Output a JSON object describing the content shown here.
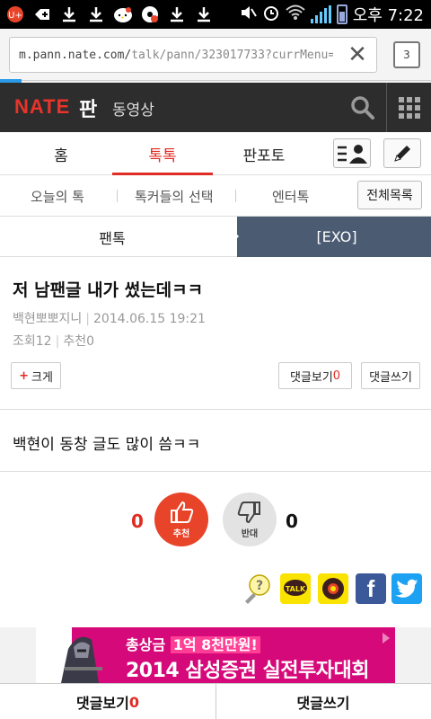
{
  "status_bar": {
    "time": "오후 7:22",
    "icons": [
      "u-plus-icon",
      "add-icon",
      "download-icon",
      "download-icon",
      "hello-kitty-icon",
      "cd-icon",
      "download-icon",
      "download-icon",
      "mute-icon",
      "alarm-icon",
      "wifi-icon",
      "signal-icon",
      "battery-icon"
    ]
  },
  "browser": {
    "url_host": "m.pann.nate.com/",
    "url_path": "talk/pann/323017733?currMenu=",
    "tab_count": "3"
  },
  "header": {
    "logo": "NATE",
    "section": "판",
    "video_link": "동영상"
  },
  "main_tabs": [
    {
      "label": "홈"
    },
    {
      "label": "톡톡",
      "active": true
    },
    {
      "label": "판포토"
    }
  ],
  "sub_tabs": [
    {
      "label": "오늘의 톡"
    },
    {
      "label": "톡커들의 선택"
    },
    {
      "label": "엔터톡"
    }
  ],
  "sub_tabs_all": "전체목록",
  "breadcrumb": {
    "left": "팬톡",
    "right": "[EXO]"
  },
  "post": {
    "title": "저 남팬글 내가 썼는데ㅋㅋ",
    "author": "백현뽀뽀지니",
    "date": "2014.06.15 19:21",
    "views_label": "조회",
    "views": "12",
    "recommend_label": "추천",
    "recommend": "0",
    "font_bigger": "크게",
    "comment_view_label": "댓글보기",
    "comment_count": "0",
    "comment_write": "댓글쓰기",
    "body": "백현이 동창 글도 많이 씀ㅋㅋ"
  },
  "votes": {
    "up_count": "0",
    "up_label": "추천",
    "down_label": "반대",
    "down_count": "0"
  },
  "share": {
    "talk_label": "TALK",
    "facebook_label": "f"
  },
  "ad": {
    "prize_prefix": "총상금",
    "prize_amount": "1억 8천만원!",
    "headline": "2014 삼성증권 실전투자대회"
  },
  "bottom_bar": {
    "comment_view_label": "댓글보기",
    "comment_count": "0",
    "comment_write": "댓글쓰기"
  },
  "colors": {
    "accent_red": "#e02c24",
    "header_bg": "#2d2d2d",
    "breadcrumb_bg": "#4a5b72",
    "ad_bg": "#d6097a"
  }
}
